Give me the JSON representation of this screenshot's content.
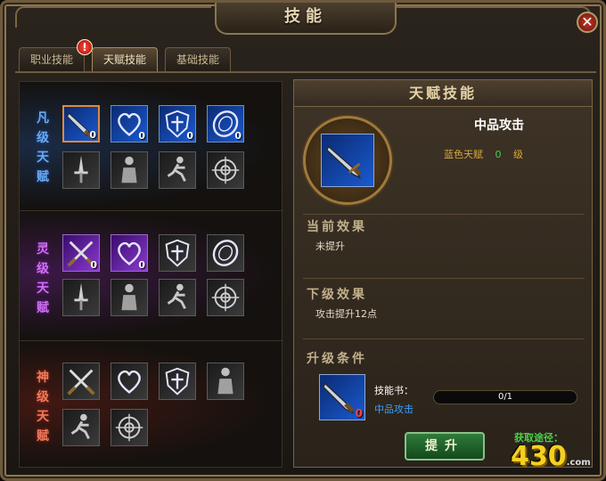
{
  "window": {
    "title": "技能",
    "close_glyph": "✕"
  },
  "tabs": [
    {
      "label": "职业技能",
      "alert": "!"
    },
    {
      "label": "天赋技能"
    },
    {
      "label": "基础技能"
    }
  ],
  "tiers": [
    {
      "label": [
        "凡",
        "级",
        "天",
        "赋"
      ],
      "color": "#6aaaf0",
      "slots": [
        {
          "icon": "sword-icon",
          "state": "learnable-blue",
          "level": "0",
          "selected": true
        },
        {
          "icon": "heart-icon",
          "state": "learnable-blue",
          "level": "0"
        },
        {
          "icon": "shield-cross-icon",
          "state": "learnable-blue",
          "level": "0"
        },
        {
          "icon": "round-shield-icon",
          "state": "learnable-blue",
          "level": "0"
        },
        {
          "icon": "dagger-icon",
          "state": "locked"
        },
        {
          "icon": "warrior-icon",
          "state": "locked"
        },
        {
          "icon": "runner-icon",
          "state": "locked"
        },
        {
          "icon": "target-icon",
          "state": "locked"
        }
      ]
    },
    {
      "label": [
        "灵",
        "级",
        "天",
        "赋"
      ],
      "color": "#d070f0",
      "slots": [
        {
          "icon": "crossed-swords-icon",
          "state": "learnable-purple",
          "level": "0"
        },
        {
          "icon": "heart-icon",
          "state": "learnable-purple",
          "level": "0"
        },
        {
          "icon": "shield-cross-icon",
          "state": "locked"
        },
        {
          "icon": "round-shield-icon",
          "state": "locked"
        },
        {
          "icon": "dagger-icon",
          "state": "locked"
        },
        {
          "icon": "warrior-icon",
          "state": "locked"
        },
        {
          "icon": "runner-icon",
          "state": "locked"
        },
        {
          "icon": "target-icon",
          "state": "locked"
        }
      ]
    },
    {
      "label": [
        "神",
        "级",
        "天",
        "赋"
      ],
      "color": "#f07a5a",
      "slots": [
        {
          "icon": "crossed-swords-icon",
          "state": "locked"
        },
        {
          "icon": "heart-icon",
          "state": "locked"
        },
        {
          "icon": "shield-cross-icon",
          "state": "locked"
        },
        {
          "icon": "warrior-icon",
          "state": "locked"
        },
        {
          "icon": "runner-icon",
          "state": "locked"
        },
        {
          "icon": "target-icon",
          "state": "locked"
        }
      ]
    }
  ],
  "detail": {
    "panel_title": "天赋技能",
    "skill_name": "中品攻击",
    "rarity": "蓝色天赋",
    "level": "0",
    "level_unit": "级",
    "current_effect_title": "当前效果",
    "current_effect": "未提升",
    "next_effect_title": "下级效果",
    "next_effect": "攻击提升12点",
    "requirement_title": "升级条件",
    "book_label": "技能书：",
    "book_item": "中品攻击",
    "book_count": "0",
    "progress_text": "0/1",
    "progress_fraction": 0,
    "upgrade_button": "提升",
    "obtain_label": "获取途径："
  },
  "watermark": {
    "brand": "430",
    "small": ".com"
  }
}
